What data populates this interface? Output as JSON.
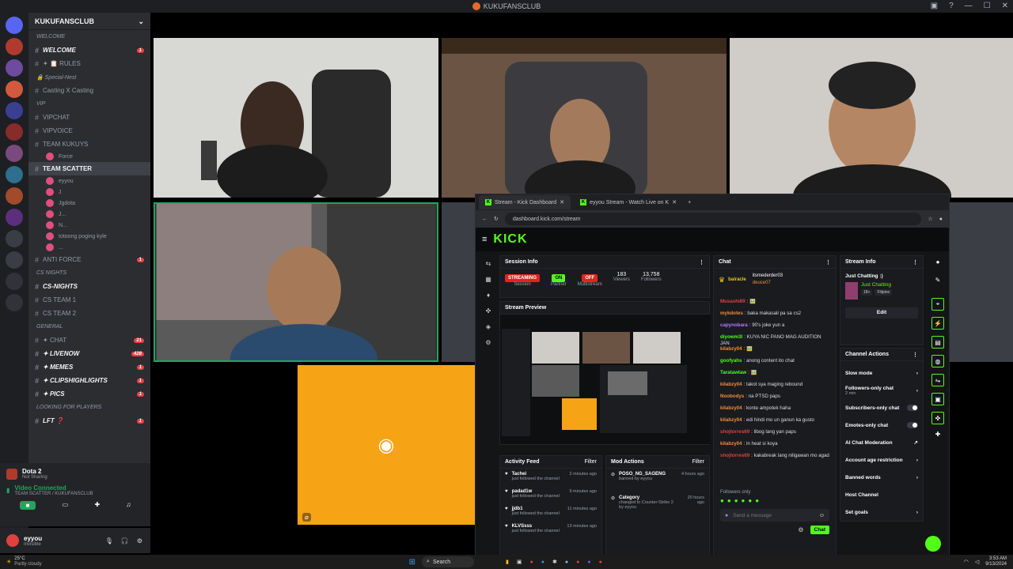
{
  "app_title": "KUKUFANSCLUB",
  "server": {
    "name": "KUKUFANSCLUB",
    "channels": [
      {
        "type": "cat",
        "label": "WELCOME"
      },
      {
        "type": "text",
        "label": "WELCOME",
        "bold": true,
        "badge": "1"
      },
      {
        "type": "text",
        "label": "✦ 📋 RULES"
      },
      {
        "type": "cat",
        "label": "🔒 Special-Nest"
      },
      {
        "type": "text",
        "label": "Casting X Casting"
      },
      {
        "type": "cat",
        "label": "VIP"
      },
      {
        "type": "text",
        "label": "VIPCHAT"
      },
      {
        "type": "text",
        "label": "VIPVOICE"
      },
      {
        "type": "text",
        "label": "TEAM KUKUYS"
      },
      {
        "type": "voice-user",
        "label": "Force"
      },
      {
        "type": "active",
        "label": "TEAM SCATTER"
      },
      {
        "type": "voice-user",
        "label": "eyyou"
      },
      {
        "type": "voice-user",
        "label": "J"
      },
      {
        "type": "voice-user",
        "label": "Jgdota"
      },
      {
        "type": "voice-user",
        "label": "J..."
      },
      {
        "type": "voice-user",
        "label": "N..."
      },
      {
        "type": "voice-user",
        "label": "totoong poging kyle"
      },
      {
        "type": "voice-user",
        "label": "..."
      },
      {
        "type": "text",
        "label": "ANTI FORCE",
        "badge": "1"
      },
      {
        "type": "cat",
        "label": "CS NIGHTS"
      },
      {
        "type": "text",
        "label": "CS-NIGHTS",
        "bold": true
      },
      {
        "type": "text",
        "label": "CS TEAM 1"
      },
      {
        "type": "text",
        "label": "CS TEAM 2"
      },
      {
        "type": "cat",
        "label": "GENERAL"
      },
      {
        "type": "text",
        "label": "✦ CHAT",
        "badge": "21"
      },
      {
        "type": "text",
        "label": "✦ LIVENOW",
        "bold": true,
        "badge": "428"
      },
      {
        "type": "text",
        "label": "✦ MEMES",
        "bold": true,
        "badge": "1"
      },
      {
        "type": "text",
        "label": "✦ CLIPSHIGHLIGHTS",
        "bold": true,
        "badge": "1"
      },
      {
        "type": "text",
        "label": "✦ PICS",
        "bold": true,
        "badge": "1"
      },
      {
        "type": "cat",
        "label": "LOOKING FOR PLAYERS"
      },
      {
        "type": "text",
        "label": "LFT ❓",
        "bold": true,
        "badge": "1"
      }
    ]
  },
  "voice_panel": {
    "activity": "Dota 2",
    "activity_sub": "Not Sharing",
    "status": "Video Connected",
    "status_sub": "TEAM SCATTER / KUKUFANSCLUB"
  },
  "user_panel": {
    "name": "eyyou",
    "status": "Invisible"
  },
  "browser": {
    "tabs": [
      {
        "label": "Stream - Kick Dashboard",
        "active": true
      },
      {
        "label": "eyyou Stream - Watch Live on K",
        "active": false
      }
    ],
    "url": "dashboard.kick.com/stream"
  },
  "kick": {
    "logo": "KICK",
    "session_info": {
      "title": "Session Info",
      "statuses": [
        {
          "pill": "STREAMING",
          "label": "Session",
          "color": "#e0241b"
        },
        {
          "pill": "ON",
          "label": "Partner",
          "color": "#53fc18"
        },
        {
          "pill": "OFF",
          "label": "Multistream",
          "color": "#e0241b"
        }
      ],
      "stats": [
        {
          "value": "183",
          "label": "Viewers"
        },
        {
          "value": "13,758",
          "label": "Followers"
        }
      ]
    },
    "stream_preview": {
      "title": "Stream Preview"
    },
    "chat": {
      "title": "Chat",
      "top_users": [
        "bairacle",
        "itsmederder03",
        "deuce07"
      ],
      "messages": [
        {
          "user": "Musashi89",
          "color": "#e0413e",
          "text": "🖼️"
        },
        {
          "user": "mykdotes",
          "color": "#f08c3c",
          "text": "baka makasali pa sa cs2"
        },
        {
          "user": "capynobara",
          "color": "#b878ff",
          "text": "90's joke yun a"
        },
        {
          "user": "diyowm3l",
          "color": "#53fc18",
          "text": "KUYA NIC PANO MAG AUDITION JAN"
        },
        {
          "user": "kilabzy04",
          "color": "#f08c3c",
          "text": "🖼️"
        },
        {
          "user": "goofyahs",
          "color": "#53fc18",
          "text": "anong content ito chat"
        },
        {
          "user": "Taratawtaw",
          "color": "#53fc18",
          "text": "🖼️"
        },
        {
          "user": "kilabzy04",
          "color": "#f08c3c",
          "text": "takot sya maging rebound"
        },
        {
          "user": "Noobodys",
          "color": "#f08c3c",
          "text": "na PTSD paps"
        },
        {
          "user": "kilabzy04",
          "color": "#f08c3c",
          "text": "konte ampotek haha"
        },
        {
          "user": "kilabzy04",
          "color": "#f08c3c",
          "text": "edi hindi mo un ganun ka gusto"
        },
        {
          "user": "shojtorres69",
          "color": "#e0413e",
          "text": "libog lang yan paps"
        },
        {
          "user": "kilabzy04",
          "color": "#f08c3c",
          "text": "in heat si koya"
        },
        {
          "user": "shojtorres69",
          "color": "#e0413e",
          "text": "kakabreak lang niligawan mo agad"
        }
      ],
      "followers_only": "Followers only",
      "placeholder": "Send a message",
      "send_label": "Chat"
    },
    "stream_info": {
      "title": "Stream Info",
      "category": "Just Chatting :)",
      "game": "Just Chatting",
      "tags": [
        "18+",
        "Filipino"
      ],
      "edit_label": "Edit"
    },
    "channel_actions": {
      "title": "Channel Actions",
      "items": [
        {
          "label": "Slow mode",
          "kind": "arrow"
        },
        {
          "label": "Followers-only chat",
          "sub": "2 min",
          "kind": "arrow"
        },
        {
          "label": "Subscribers-only chat",
          "kind": "toggle"
        },
        {
          "label": "Emotes-only chat",
          "kind": "toggle"
        },
        {
          "label": "AI Chat Moderation",
          "kind": "link"
        },
        {
          "label": "Account age restriction",
          "kind": "arrow"
        },
        {
          "label": "Banned words",
          "kind": "arrow"
        },
        {
          "label": "Host Channel",
          "kind": "none"
        },
        {
          "label": "Set goals",
          "kind": "arrow"
        }
      ]
    },
    "activity_feed": {
      "title": "Activity Feed",
      "filter": "Filter",
      "items": [
        {
          "name": "Tachei",
          "text": "just followed the channel",
          "time": "2 minutes ago"
        },
        {
          "name": "padad1w",
          "text": "just followed the channel",
          "time": "9 minutes ago"
        },
        {
          "name": "jjdb1",
          "text": "just followed the channel",
          "time": "11 minutes ago"
        },
        {
          "name": "KLVSsss",
          "text": "just followed the channel",
          "time": "13 minutes ago"
        }
      ]
    },
    "mod_actions": {
      "title": "Mod Actions",
      "filter": "Filter",
      "items": [
        {
          "name": "POSO_NG_SAGENG",
          "text": "banned by eyyou",
          "time": "4 hours ago"
        },
        {
          "name": "Category",
          "text": "changed to Counter-Strike 2 by eyyou",
          "time": "20 hours ago"
        }
      ]
    }
  },
  "taskbar": {
    "weather": "25°C",
    "weather_sub": "Partly cloudy",
    "search": "Search",
    "time": "3:53 AM",
    "date": "9/13/2024"
  },
  "colors": {
    "kick_green": "#53fc18",
    "discord_orange": "#f6a316"
  }
}
